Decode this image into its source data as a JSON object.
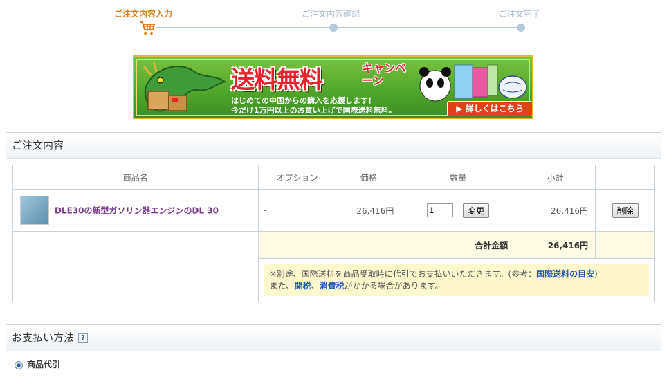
{
  "steps": {
    "step1": "ご注文内容入力",
    "step2": "ご注文内容確認",
    "step3": "ご注文完了"
  },
  "banner": {
    "title": "送料無料",
    "campaign": "キャンペーン",
    "subtitle_line1": "はじめての中国からの購入を応援します！",
    "subtitle_line2": "今だけ1万円以上のお買い上げで国際送料無料。",
    "button": "▶ 詳しくはこちら"
  },
  "order": {
    "heading": "ご注文内容",
    "columns": [
      "商品名",
      "オプション",
      "価格",
      "数量",
      "小計",
      ""
    ],
    "item": {
      "name": "DLE30の新型ガソリン器エンジンのDL 30",
      "option": "-",
      "price": "26,416円",
      "quantity": "1",
      "update_label": "変更",
      "subtotal": "26,416円",
      "delete_label": "削除"
    },
    "total_label": "合計金額",
    "total_value": "26,416円",
    "note": {
      "part1": "※別途、国際送料を商品受取時に代引でお支払いいただきます。(参考：",
      "link1": "国際送料の目安",
      "part2": ")",
      "part3": "また、",
      "link2": "関税",
      "sep": "、",
      "link3": "消費税",
      "part4": "がかかる場合があります。"
    }
  },
  "payment": {
    "heading": "お支払い方法",
    "help": "?",
    "option": "商品代引"
  },
  "colors": {
    "active_step": "#e2791c",
    "inactive_step": "#a9bcd0",
    "link_purple": "#7a3a8f",
    "link_blue": "#1f57b8",
    "note_bg": "#fff8cc"
  }
}
